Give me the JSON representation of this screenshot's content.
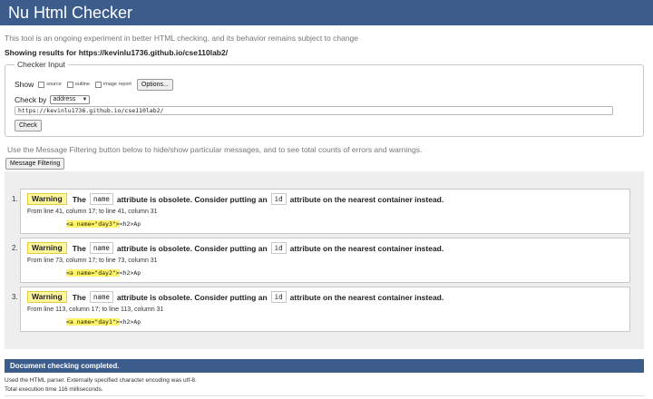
{
  "header": {
    "title": "Nu Html Checker"
  },
  "intro": "This tool is an ongoing experiment in better HTML checking, and its behavior remains subject to change",
  "showing": "Showing results for https://kevinlu1736.github.io/cse110lab2/",
  "checker_input": {
    "legend": "Checker Input",
    "show_label": "Show",
    "options": [
      {
        "label": "source",
        "checked": false
      },
      {
        "label": "outline",
        "checked": false
      },
      {
        "label": "image report",
        "checked": false
      }
    ],
    "options_button": "Options...",
    "check_by_label": "Check by",
    "check_by_value": "address",
    "url_value": "https://kevinlu1736.github.io/cse110lab2/",
    "check_button": "Check"
  },
  "filter_note": "Use the Message Filtering button below to hide/show particular messages, and to see total counts of errors and warnings.",
  "filter_button": "Message Filtering",
  "messages": [
    {
      "num": "1.",
      "type": "Warning",
      "text_the": "The",
      "code_name": "name",
      "text_mid": "attribute is obsolete. Consider putting an",
      "code_id": "id",
      "text_end": "attribute on the nearest container instead.",
      "location": "From line 41, column 17; to line 41, column 31",
      "extract_hl": "<a name=\"day3\">",
      "extract_rest": "<h2>Ap"
    },
    {
      "num": "2.",
      "type": "Warning",
      "text_the": "The",
      "code_name": "name",
      "text_mid": "attribute is obsolete. Consider putting an",
      "code_id": "id",
      "text_end": "attribute on the nearest container instead.",
      "location": "From line 73, column 17; to line 73, column 31",
      "extract_hl": "<a name=\"day2\">",
      "extract_rest": "<h2>Ap"
    },
    {
      "num": "3.",
      "type": "Warning",
      "text_the": "The",
      "code_name": "name",
      "text_mid": "attribute is obsolete. Consider putting an",
      "code_id": "id",
      "text_end": "attribute on the nearest container instead.",
      "location": "From line 113, column 17; to line 113, column 31",
      "extract_hl": "<a name=\"day1\">",
      "extract_rest": "<h2>Ap"
    }
  ],
  "done": "Document checking completed.",
  "footer": {
    "parser": "Used the HTML parser. Externally specified character encoding was utf-8.",
    "time": "Total execution time 116 milliseconds."
  },
  "colors": {
    "header": "#3c5c8c",
    "warning_bg": "#fff6a0",
    "highlight": "#fff36a"
  }
}
